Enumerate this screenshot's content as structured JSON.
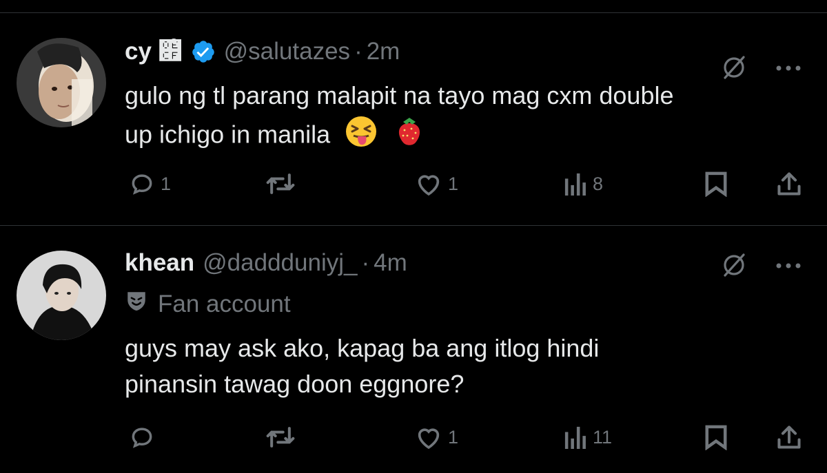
{
  "tweets": [
    {
      "name": "cy ໏ໍ",
      "verified": true,
      "handle": "@salutazes",
      "separator": "·",
      "time": "2m",
      "label": "",
      "text_line1": "gulo ng tl parang malapit na tayo mag cxm double",
      "text_line2": "up ichigo in manila",
      "emojis": [
        "squinting-tongue-face",
        "strawberry"
      ],
      "replies": "1",
      "reposts": "",
      "likes": "1",
      "views": "8"
    },
    {
      "name": "khean",
      "verified": false,
      "handle": "@daddduniyj_",
      "separator": "·",
      "time": "4m",
      "label": "Fan account",
      "text_line1": "guys may ask ako, kapag ba ang itlog hindi",
      "text_line2": "pinansin tawag doon eggnore?",
      "replies": "",
      "reposts": "",
      "likes": "1",
      "views": "11"
    }
  ],
  "colors": {
    "background": "#000000",
    "text": "#e7e9ea",
    "muted": "#71767b",
    "verified": "#1d9bf0",
    "divider": "#2f3336"
  },
  "icons": [
    "grok-icon",
    "more-icon",
    "reply-icon",
    "repost-icon",
    "like-icon",
    "views-icon",
    "bookmark-icon",
    "share-icon",
    "verified-icon",
    "fan-account-icon"
  ]
}
